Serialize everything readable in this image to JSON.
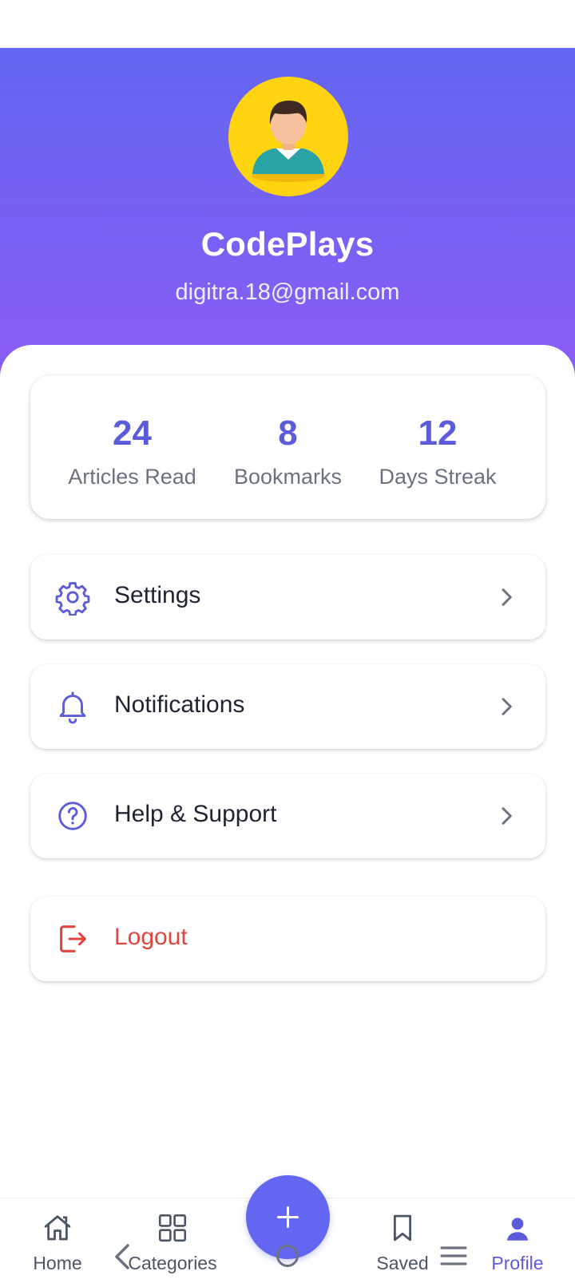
{
  "profile": {
    "name": "CodePlays",
    "email": "digitra.18@gmail.com"
  },
  "stats": [
    {
      "value": "24",
      "label": "Articles Read"
    },
    {
      "value": "8",
      "label": "Bookmarks"
    },
    {
      "value": "12",
      "label": "Days Streak"
    }
  ],
  "menu": {
    "settings": {
      "label": "Settings",
      "icon": "gear-icon"
    },
    "notifications": {
      "label": "Notifications",
      "icon": "bell-icon"
    },
    "help": {
      "label": "Help & Support",
      "icon": "question-circle-icon"
    },
    "logout": {
      "label": "Logout",
      "icon": "logout-icon"
    }
  },
  "nav": {
    "home": "Home",
    "categories": "Categories",
    "saved": "Saved",
    "profile": "Profile",
    "active": "profile"
  },
  "colors": {
    "accent": "#6366f1",
    "header_gradient_start": "#6366f1",
    "header_gradient_end": "#8b5cf6",
    "stat_value": "#5b5bdc",
    "logout": "#e0453f",
    "avatar_bg": "#fdd40f"
  }
}
